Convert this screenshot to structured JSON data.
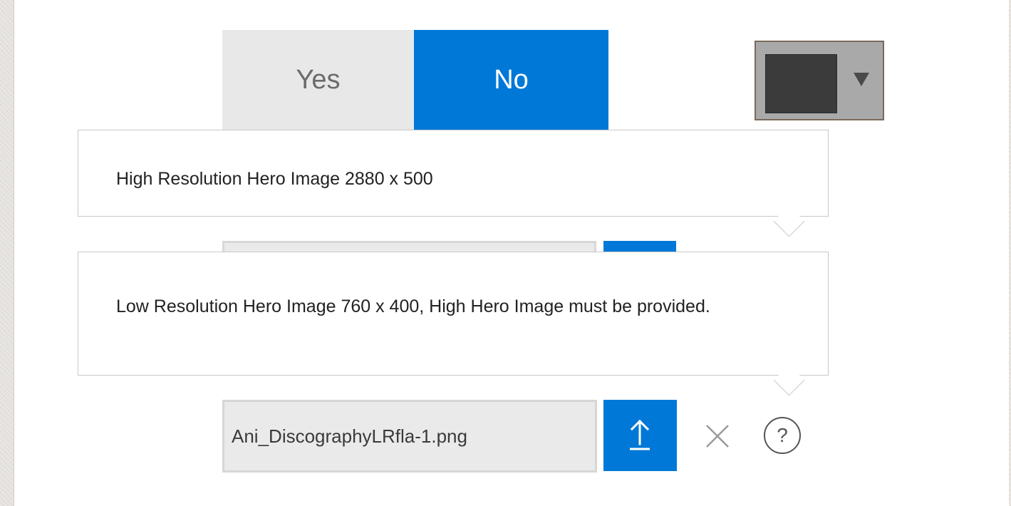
{
  "toggle": {
    "yes_label": "Yes",
    "no_label": "No",
    "selected": "No"
  },
  "color_picker": {
    "swatch_color": "#3b3b3b"
  },
  "tooltips": {
    "high_res": "High Resolution Hero Image 2880 x 500",
    "low_res": "Low Resolution Hero Image 760 x 400, High Hero Image must be provided."
  },
  "file_upload": {
    "filename": "Ani_DiscographyLRfla-1.png",
    "help_label": "?"
  },
  "colors": {
    "accent": "#0078d7",
    "toggle_inactive": "#e8e8e8",
    "text": "#222222"
  }
}
